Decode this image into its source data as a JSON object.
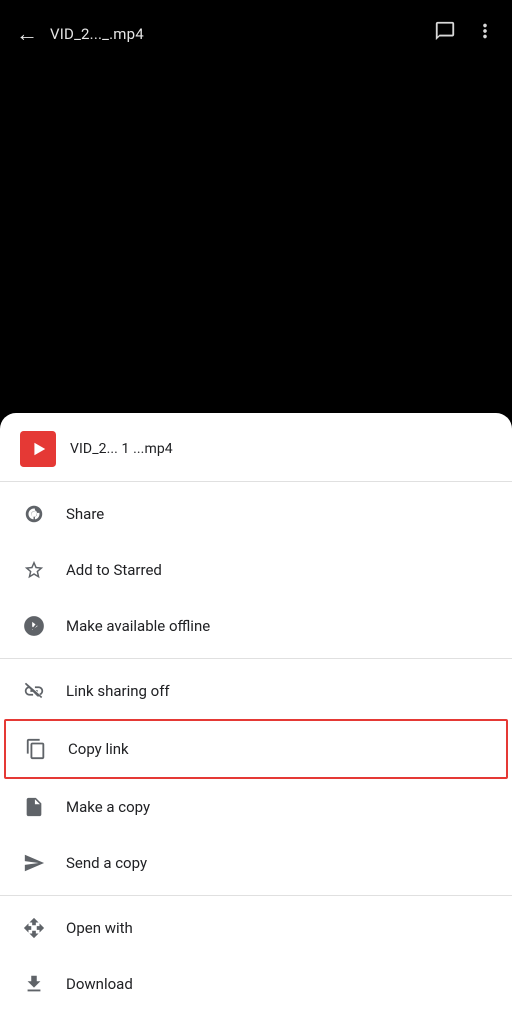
{
  "header": {
    "back_label": "←",
    "title": "VID_2..._.mp4",
    "comment_icon": "comment-icon",
    "more_icon": "more-icon"
  },
  "file": {
    "name": "VID_2... 1 ...mp4",
    "icon_color": "#e53935"
  },
  "menu": {
    "sections": [
      {
        "items": [
          {
            "id": "share",
            "label": "Share",
            "icon": "person-add"
          },
          {
            "id": "add-starred",
            "label": "Add to Starred",
            "icon": "star"
          },
          {
            "id": "offline",
            "label": "Make available offline",
            "icon": "offline-pin"
          }
        ]
      },
      {
        "items": [
          {
            "id": "link-sharing",
            "label": "Link sharing off",
            "icon": "link-off"
          },
          {
            "id": "copy-link",
            "label": "Copy link",
            "icon": "copy",
            "highlighted": true
          },
          {
            "id": "make-copy",
            "label": "Make a copy",
            "icon": "copy-file"
          },
          {
            "id": "send-copy",
            "label": "Send a copy",
            "icon": "send"
          }
        ]
      },
      {
        "items": [
          {
            "id": "open-with",
            "label": "Open with",
            "icon": "open-with"
          },
          {
            "id": "download",
            "label": "Download",
            "icon": "download"
          }
        ]
      }
    ]
  }
}
